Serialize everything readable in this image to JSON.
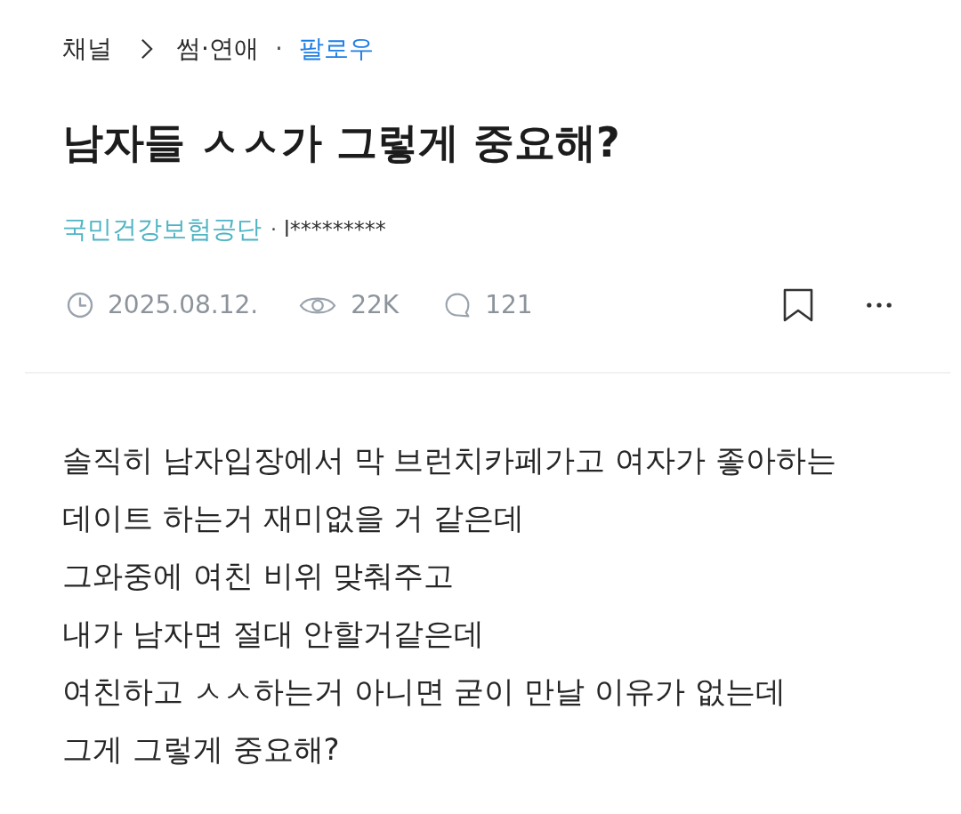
{
  "breadcrumb": {
    "channel": "채널",
    "category": "썸·연애",
    "separator": "·",
    "follow": "팔로우"
  },
  "title": "남자들 ㅅㅅ가 그렇게 중요해?",
  "author": {
    "name": "국민건강보험공단",
    "separator": "·",
    "id": "l*********"
  },
  "meta": {
    "date": "2025.08.12.",
    "views": "22K",
    "comments": "121",
    "bookmarked": false
  },
  "body_lines": [
    "솔직히 남자입장에서 막 브런치카페가고 여자가 좋아하는",
    "데이트 하는거 재미없을 거 같은데",
    "그와중에 여친 비위 맞춰주고",
    "내가 남자면 절대 안할거같은데",
    "여친하고 ㅅㅅ하는거 아니면 굳이 만날 이유가 없는데",
    "그게 그렇게 중요해?"
  ]
}
